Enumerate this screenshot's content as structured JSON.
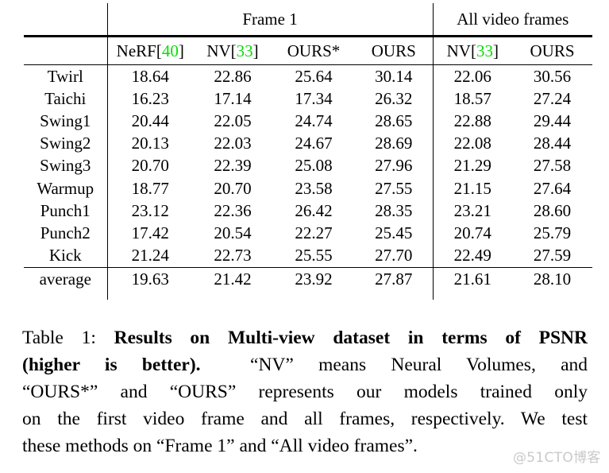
{
  "table": {
    "group_headers": [
      {
        "label": "",
        "span": 1
      },
      {
        "label": "Frame 1",
        "span": 4
      },
      {
        "label": "All video frames",
        "span": 2
      }
    ],
    "group_frame1": "Frame 1",
    "group_allframes": "All video frames",
    "columns": [
      {
        "name": "",
        "cite": ""
      },
      {
        "name": "NeRF",
        "cite": "40"
      },
      {
        "name": "NV",
        "cite": "33"
      },
      {
        "name": "OURS*",
        "cite": ""
      },
      {
        "name": "OURS",
        "cite": ""
      },
      {
        "name": "NV",
        "cite": "33"
      },
      {
        "name": "OURS",
        "cite": ""
      }
    ],
    "col_label_nerf": "NeRF",
    "col_cite_nerf": "40",
    "col_label_nv1": "NV",
    "col_cite_nv1": "33",
    "col_label_ours_star": "OURS*",
    "col_label_ours1": "OURS",
    "col_label_nv2": "NV",
    "col_cite_nv2": "33",
    "col_label_ours2": "OURS",
    "bracket_open": "[",
    "bracket_close": "]",
    "rows": [
      {
        "label": "Twirl",
        "nerf": "18.64",
        "nv1": "22.86",
        "ours1s": "25.64",
        "ours1": "30.14",
        "nv2": "22.06",
        "ours2": "30.56"
      },
      {
        "label": "Taichi",
        "nerf": "16.23",
        "nv1": "17.14",
        "ours1s": "17.34",
        "ours1": "26.32",
        "nv2": "18.57",
        "ours2": "27.24"
      },
      {
        "label": "Swing1",
        "nerf": "20.44",
        "nv1": "22.05",
        "ours1s": "24.74",
        "ours1": "28.65",
        "nv2": "22.88",
        "ours2": "29.44"
      },
      {
        "label": "Swing2",
        "nerf": "20.13",
        "nv1": "22.03",
        "ours1s": "24.67",
        "ours1": "28.69",
        "nv2": "22.08",
        "ours2": "28.44"
      },
      {
        "label": "Swing3",
        "nerf": "20.70",
        "nv1": "22.39",
        "ours1s": "25.08",
        "ours1": "27.96",
        "nv2": "21.29",
        "ours2": "27.58"
      },
      {
        "label": "Warmup",
        "nerf": "18.77",
        "nv1": "20.70",
        "ours1s": "23.58",
        "ours1": "27.55",
        "nv2": "21.15",
        "ours2": "27.64"
      },
      {
        "label": "Punch1",
        "nerf": "23.12",
        "nv1": "22.36",
        "ours1s": "26.42",
        "ours1": "28.35",
        "nv2": "23.21",
        "ours2": "28.60"
      },
      {
        "label": "Punch2",
        "nerf": "17.42",
        "nv1": "20.54",
        "ours1s": "22.27",
        "ours1": "25.45",
        "nv2": "20.74",
        "ours2": "25.79"
      },
      {
        "label": "Kick",
        "nerf": "21.24",
        "nv1": "22.73",
        "ours1s": "25.55",
        "ours1": "27.70",
        "nv2": "22.49",
        "ours2": "27.59"
      }
    ],
    "average": {
      "label": "average",
      "nerf": "19.63",
      "nv1": "21.42",
      "ours1s": "23.92",
      "ours1": "27.87",
      "nv2": "21.61",
      "ours2": "28.10"
    }
  },
  "caption": {
    "prefix": "Table 1:",
    "bold_part": "Results on Multi-view dataset in terms of PSNR (higher is better).",
    "rest": "“NV” means Neural Volumes, and “OURS*” and “OURS” represents our models trained only on the first video frame and all frames, respectively. We test these methods on “Frame 1” and “All video frames”.",
    "line1_label": "Table 1:",
    "line1_bold": "Results on Multi-view dataset in terms of PSNR",
    "line2_bold": "(higher is better).",
    "line2_rest": "“NV” means Neural Volumes, and",
    "line3": "“OURS*” and “OURS” represents our models trained only",
    "line4": "on the first video frame and all frames, respectively. We test",
    "line5": "these methods on “Frame 1” and “All video frames”."
  },
  "watermark": {
    "text": "@51CTO博客"
  },
  "colors": {
    "citation_green": "#00e000",
    "text": "#000000",
    "background": "#ffffff",
    "watermark": "#c9c9c9"
  }
}
